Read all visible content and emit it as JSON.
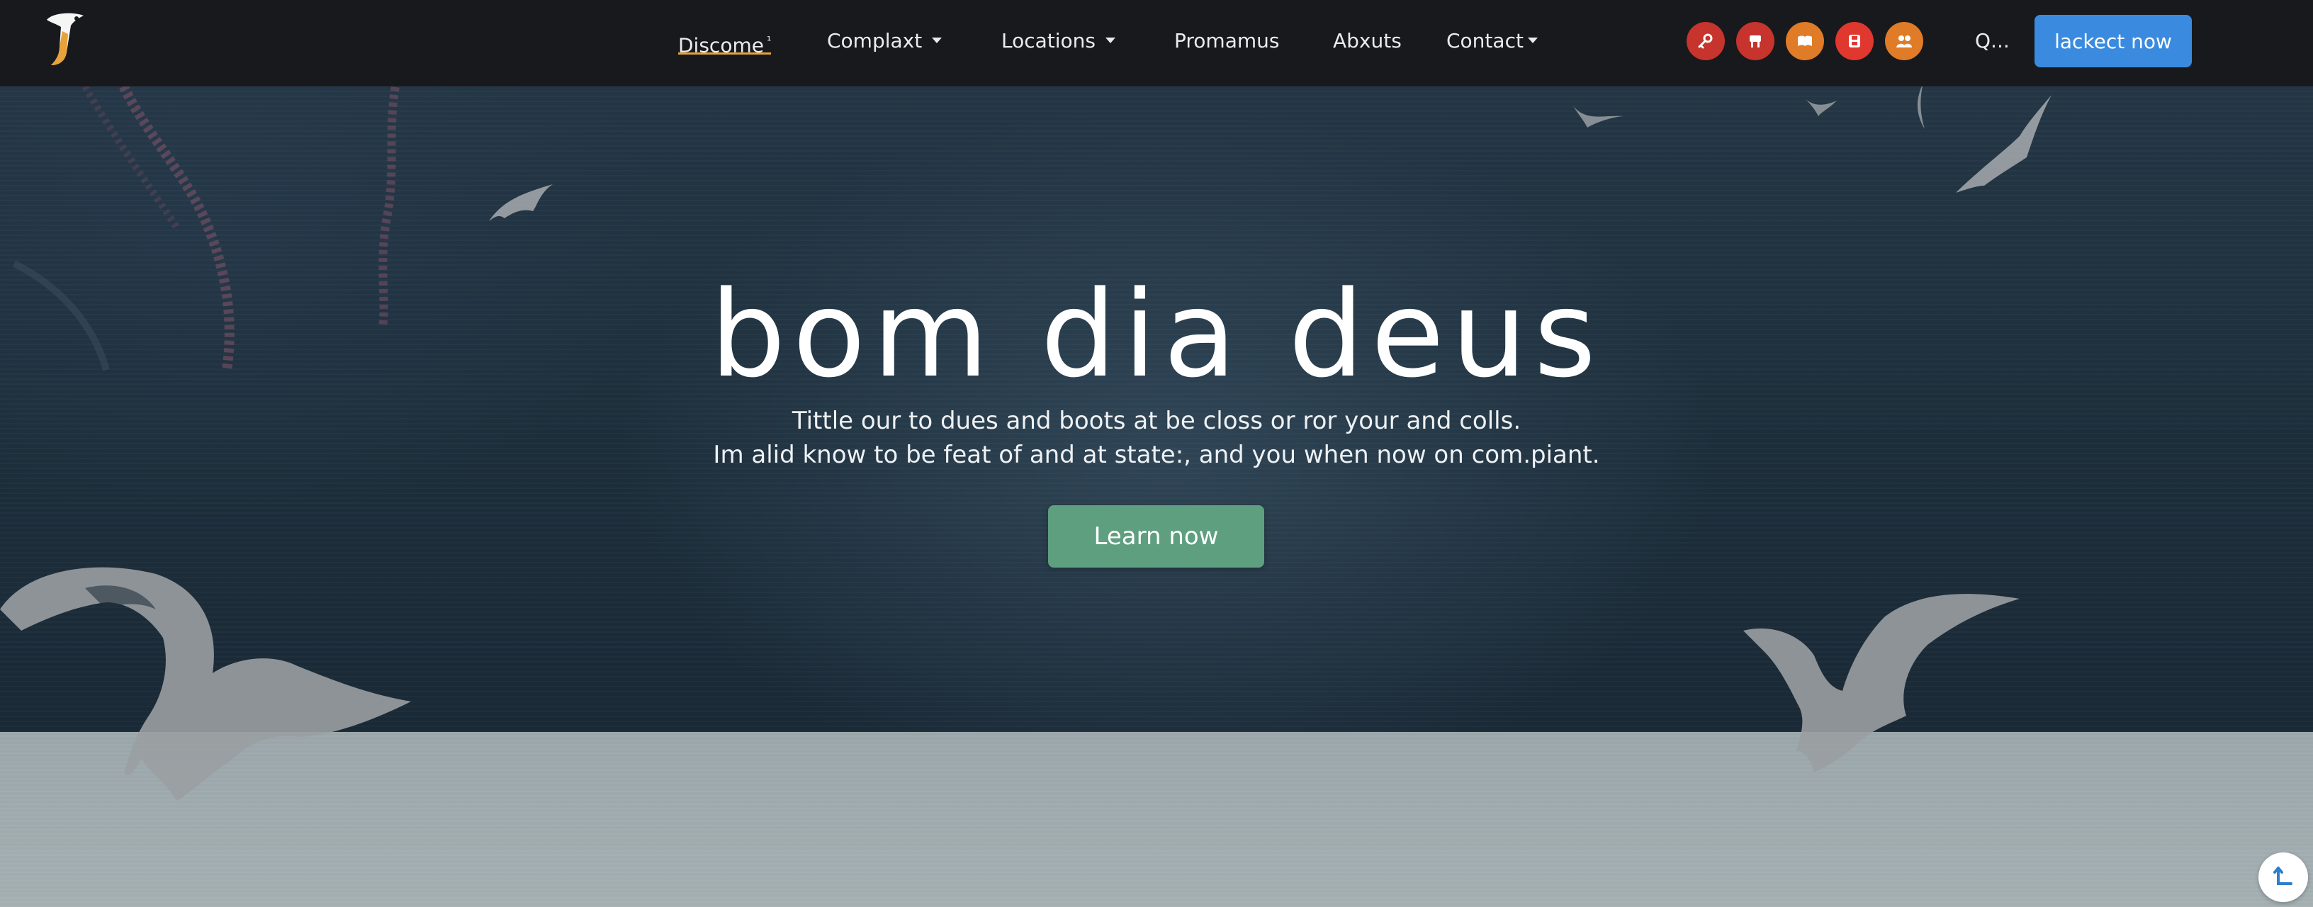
{
  "nav": {
    "logo": "logo",
    "links": [
      {
        "label": "Discome",
        "sup": "¹",
        "active": true
      },
      {
        "label": "Complaxt",
        "dropdown": true
      },
      {
        "label": "Locations",
        "dropdown": true
      },
      {
        "label": "Promamus"
      },
      {
        "label": "Abxuts"
      },
      {
        "label": "Contact",
        "dropdown": true
      }
    ],
    "social_icons": [
      {
        "icon": "key-icon",
        "color": "#c7332d"
      },
      {
        "icon": "music-icon",
        "color": "#c7332d"
      },
      {
        "icon": "book-icon",
        "color": "#e07b27"
      },
      {
        "icon": "save-icon",
        "color": "#e0372f"
      },
      {
        "icon": "users-icon",
        "color": "#e07b27"
      }
    ],
    "search_label": "Q...",
    "cta_label": "lackect now",
    "cta_color": "#3a8bdf"
  },
  "hero": {
    "title": "bom dia deus",
    "subtitle_line1": "Tittle our to dues and boots at be closs or ror your and colls.",
    "subtitle_line2": "Im alid know to be feat of and at state:, and you when now on com.piant.",
    "button_label": "Learn now",
    "button_color": "#5e9f7f"
  },
  "footer": {
    "scroll_icon": "scroll-up-icon"
  }
}
